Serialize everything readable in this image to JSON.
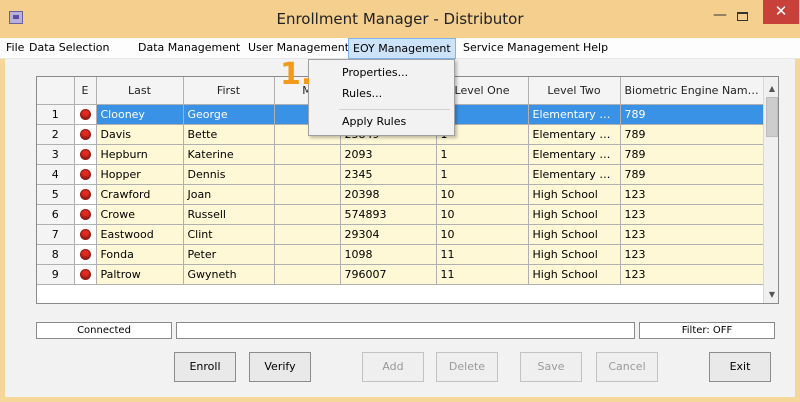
{
  "window": {
    "title": "Enrollment Manager - Distributor",
    "close_glyph": "✕",
    "minimize_glyph": "—"
  },
  "menubar": [
    "File",
    "Data Selection",
    "Data Management",
    "User Management",
    "EOY Management",
    "Service Management",
    "Help"
  ],
  "dropdown": {
    "items": [
      "Properties...",
      "Rules...",
      "Apply Rules"
    ]
  },
  "callout": "1.",
  "grid": {
    "columns": [
      "",
      "E",
      "Last",
      "First",
      "M",
      "",
      "Level One",
      "Level Two",
      "Biometric Engine Names"
    ],
    "rows": [
      {
        "n": "1",
        "last": "Clooney",
        "first": "George",
        "m": "",
        "id": "",
        "l1": "",
        "l2": "Elementary Sc...",
        "bio": "789",
        "selected": true
      },
      {
        "n": "2",
        "last": "Davis",
        "first": "Bette",
        "m": "",
        "id": "23849",
        "l1": "1",
        "l2": "Elementary Sc...",
        "bio": "789"
      },
      {
        "n": "3",
        "last": "Hepburn",
        "first": "Katerine",
        "m": "",
        "id": "2093",
        "l1": "1",
        "l2": "Elementary Sc...",
        "bio": "789"
      },
      {
        "n": "4",
        "last": "Hopper",
        "first": "Dennis",
        "m": "",
        "id": "2345",
        "l1": "1",
        "l2": "Elementary Sc...",
        "bio": "789"
      },
      {
        "n": "5",
        "last": "Crawford",
        "first": "Joan",
        "m": "",
        "id": "20398",
        "l1": "10",
        "l2": "High School",
        "bio": "123"
      },
      {
        "n": "6",
        "last": "Crowe",
        "first": "Russell",
        "m": "",
        "id": "574893",
        "l1": "10",
        "l2": "High School",
        "bio": "123"
      },
      {
        "n": "7",
        "last": "Eastwood",
        "first": "Clint",
        "m": "",
        "id": "29304",
        "l1": "10",
        "l2": "High School",
        "bio": "123"
      },
      {
        "n": "8",
        "last": "Fonda",
        "first": "Peter",
        "m": "",
        "id": "1098",
        "l1": "11",
        "l2": "High School",
        "bio": "123"
      },
      {
        "n": "9",
        "last": "Paltrow",
        "first": "Gwyneth",
        "m": "",
        "id": "796007",
        "l1": "11",
        "l2": "High School",
        "bio": "123"
      }
    ]
  },
  "status": {
    "connection": "Connected",
    "message": "",
    "filter": "Filter: OFF"
  },
  "buttons": {
    "enroll": "Enroll",
    "verify": "Verify",
    "add": "Add",
    "delete": "Delete",
    "save": "Save",
    "cancel": "Cancel",
    "exit": "Exit"
  },
  "colors": {
    "accent_selected": "#3a92e6",
    "row_bg": "#fff8d6",
    "title_bg": "#f4cf8e",
    "close_red": "#c7413a",
    "status_dot": "#e02a1e",
    "callout": "#f39a1b"
  }
}
